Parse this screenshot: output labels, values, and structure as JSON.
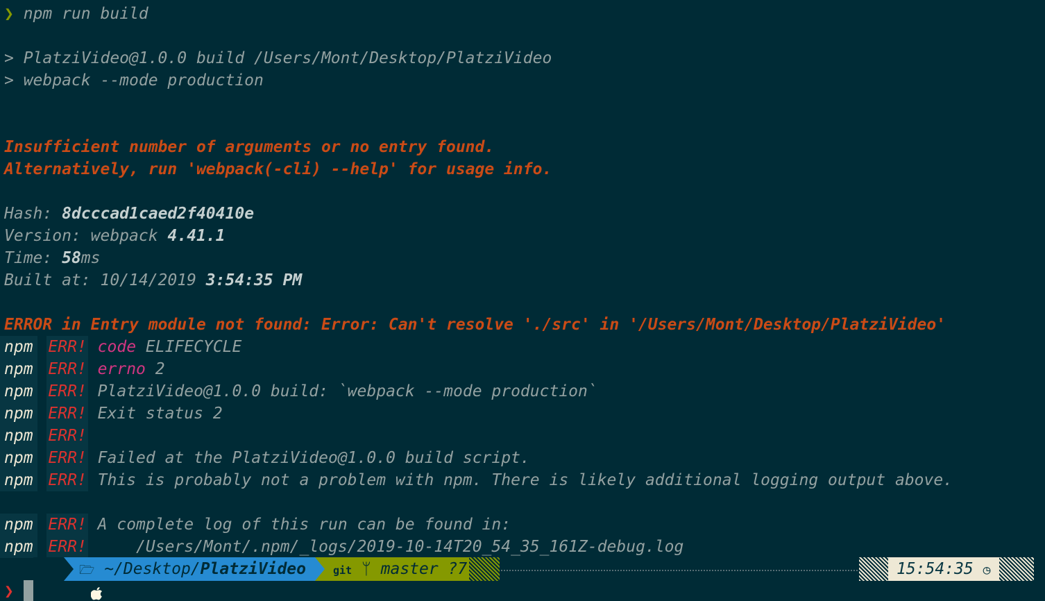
{
  "prompt_symbol": "❯",
  "command": "npm run build",
  "script_lines": [
    "> PlatziVideo@1.0.0 build /Users/Mont/Desktop/PlatziVideo",
    "> webpack --mode production"
  ],
  "error_lines": [
    "Insufficient number of arguments or no entry found.",
    "Alternatively, run 'webpack(-cli) --help' for usage info."
  ],
  "stats": {
    "hash_label": "Hash: ",
    "hash_value": "8dcccad1caed2f40410e",
    "version_label": "Version: webpack ",
    "version_value": "4.41.1",
    "time_label": "Time: ",
    "time_value": "58",
    "time_unit": "ms",
    "built_label": "Built at: 10/14/2019 ",
    "built_value": "3:54:35 PM"
  },
  "entry_error": "ERROR in Entry module not found: Error: Can't resolve './src' in '/Users/Mont/Desktop/PlatziVideo'",
  "npm_prefix": "npm",
  "err_tag": "ERR!",
  "npm_err": {
    "code_key": "code",
    "code_value": " ELIFECYCLE",
    "errno_key": "errno",
    "errno_value": " 2",
    "line3": "PlatziVideo@1.0.0 build: `webpack --mode production`",
    "line4": "Exit status 2",
    "line6": "Failed at the PlatziVideo@1.0.0 build script.",
    "line7": "This is probably not a problem with npm. There is likely additional logging output above.",
    "line8": "A complete log of this run can be found in:",
    "line9": "    /Users/Mont/.npm/_logs/2019-10-14T20_54_35_161Z-debug.log"
  },
  "status_bar": {
    "os_icon": "apple-icon",
    "folder_icon": "folder-icon",
    "dir_prefix": "~/Desktop/",
    "dir_last": "PlatziVideo",
    "git_label": "git",
    "branch_icon": "git-branch-icon",
    "branch": "master ?7",
    "time": "15:54:35",
    "clock_icon": "clock-icon"
  },
  "colors": {
    "background": "#002b36",
    "error": "#cb4b16",
    "err_tag": "#dc322f",
    "dir_segment": "#268bd2",
    "git_segment": "#859900",
    "time_segment": "#eee8d5"
  }
}
